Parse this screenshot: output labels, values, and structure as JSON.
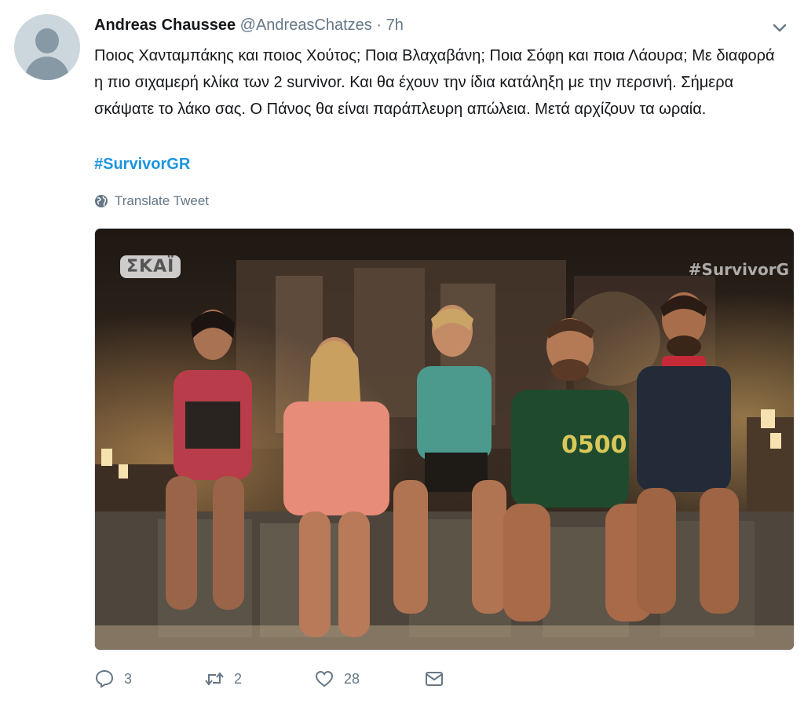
{
  "tweet": {
    "author_name": "Andreas Chaussee",
    "author_handle": "@AndreasChatzes",
    "separator": "·",
    "time": "7h",
    "text": "Ποιος Χανταμπάκης και ποιος Χούτος; Ποια Βλαχαβάνη; Ποια Σόφη και ποια Λάουρα; Με διαφορά η πιο σιχαμερή κλίκα των 2 survivor. Και θα έχουν την ίδια κατάληξη με την περσινή. Σήμερα σκάψατε το λάκο σας. Ο Πάνος θα είναι παράπλευρη απώλεια. Μετά αρχίζουν τα ωραία.",
    "hashtag": "#SurvivorGR",
    "translate_label": "Translate Tweet"
  },
  "media": {
    "watermark_left": "ΣΚΑΪ",
    "watermark_right": "#SurvivorG",
    "shirt_number": "0500"
  },
  "actions": {
    "reply_count": "3",
    "retweet_count": "2",
    "like_count": "28"
  },
  "colors": {
    "link": "#1b95e0",
    "secondary_text": "#657786",
    "primary_text": "#14171a",
    "avatar_bg": "#ccd6dd"
  },
  "icons": [
    "default-avatar-icon",
    "chevron-down-icon",
    "globe-icon",
    "reply-icon",
    "retweet-icon",
    "like-icon",
    "direct-message-icon"
  ]
}
